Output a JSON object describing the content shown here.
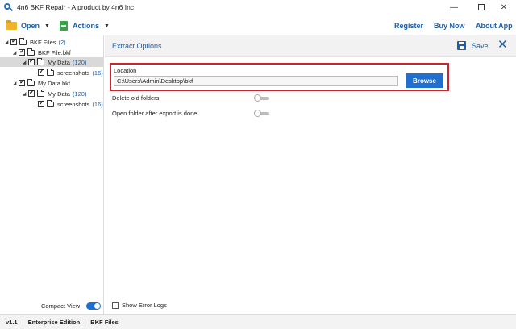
{
  "window": {
    "title": "4n6 BKF Repair - A product by 4n6 Inc",
    "controls": {
      "minimize": "—",
      "close": "✕"
    }
  },
  "toolbar": {
    "open_label": "Open",
    "actions_label": "Actions",
    "register_label": "Register",
    "buynow_label": "Buy Now",
    "about_label": "About App"
  },
  "tree": {
    "nodes": [
      {
        "label": "BKF Files",
        "count": "(2)",
        "checked": true,
        "expanded": true
      },
      {
        "label": "BKF File.bkf",
        "count": "",
        "checked": true,
        "expanded": true
      },
      {
        "label": "My Data",
        "count": "(120)",
        "checked": true,
        "expanded": true,
        "selected": true
      },
      {
        "label": "screenshots",
        "count": "(16)",
        "checked": true
      },
      {
        "label": "My Data.bkf",
        "count": "",
        "checked": true,
        "expanded": true
      },
      {
        "label": "My Data",
        "count": "(120)",
        "checked": true,
        "expanded": true
      },
      {
        "label": "screenshots",
        "count": "(16)",
        "checked": true
      }
    ],
    "compact_view_label": "Compact View",
    "compact_view_on": true
  },
  "panel": {
    "title": "Extract Options",
    "save_label": "Save",
    "location_label": "Location",
    "location_value": "C:\\Users\\Admin\\Desktop\\bkf",
    "browse_label": "Browse",
    "options": [
      {
        "label": "Delete old folders",
        "on": false
      },
      {
        "label": "Open folder after export is done",
        "on": false
      }
    ],
    "show_error_logs_label": "Show Error Logs"
  },
  "status": {
    "version": "v1.1",
    "edition": "Enterprise Edition",
    "mode": "BKF Files"
  },
  "colors": {
    "accent": "#1f6fd0",
    "link": "#1f5fa8",
    "highlight_border": "#c9252f"
  },
  "icons": {
    "app": "magnifier-icon",
    "open": "folder-icon",
    "actions": "document-icon",
    "save": "floppy-disk-icon",
    "close": "close-icon"
  }
}
